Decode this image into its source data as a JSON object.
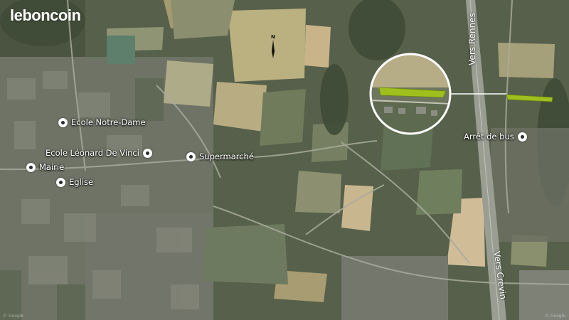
{
  "brand": {
    "logo_text": "leboncoin"
  },
  "compass": {
    "label": "N"
  },
  "pois": [
    {
      "id": "ecole-notre-dame",
      "label": "Ecole Notre-Dame"
    },
    {
      "id": "ecole-leonard",
      "label": "Ecole Léonard De Vinci"
    },
    {
      "id": "supermarche",
      "label": "Supermarché"
    },
    {
      "id": "mairie",
      "label": "Mairie"
    },
    {
      "id": "eglise",
      "label": "Eglise"
    },
    {
      "id": "arret-bus",
      "label": "Arrêt de bus"
    }
  ],
  "roads": {
    "north": "Vers Rennes",
    "south": "Vers Crevin"
  },
  "credits": {
    "left": "© Google",
    "right": "© Google"
  },
  "colors": {
    "parcel_highlight": "#9fbf1e",
    "callout_ring": "#ffffff",
    "label_text": "#ffffff"
  }
}
